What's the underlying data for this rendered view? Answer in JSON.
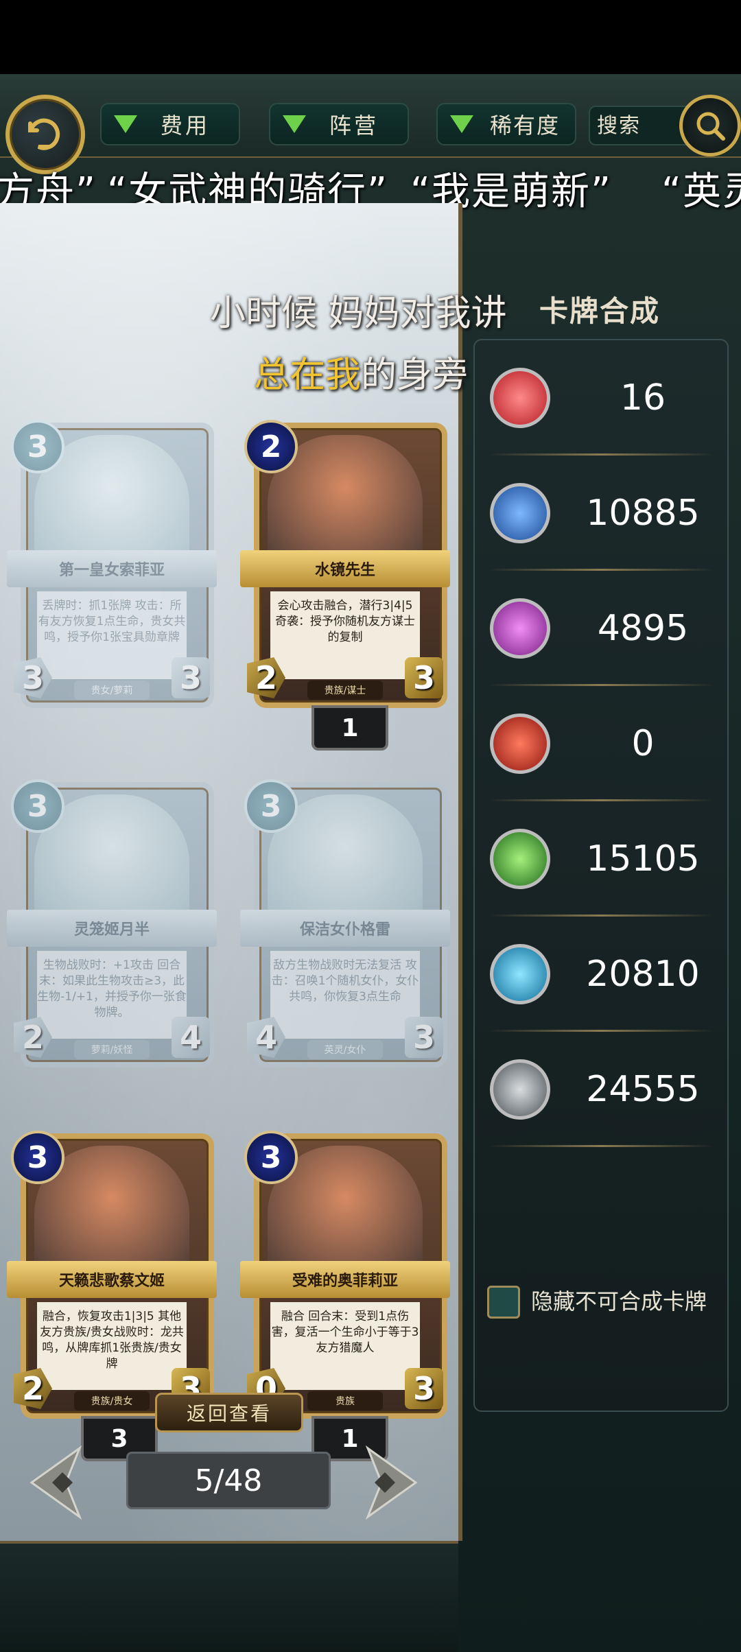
{
  "filters": [
    {
      "label": "费用"
    },
    {
      "label": "阵营"
    },
    {
      "label": "稀有度"
    }
  ],
  "search": {
    "label": "搜索"
  },
  "marquee": [
    "方舟”",
    "“女武神的骑行”",
    "“我是萌新”",
    "“英灵"
  ],
  "lyrics": {
    "line1": "小时候 妈妈对我讲",
    "line2_highlight": "总在我",
    "line2_rest": "的身旁"
  },
  "panel_title": "卡牌合成",
  "cards": [
    {
      "cost": "3",
      "name": "第一皇女索菲亚",
      "desc": "丢牌时：抓1张牌 攻击：所有友方恢复1点生命，贵女共鸣，授予你1张宝具勋章牌",
      "atk": "3",
      "hp": "3",
      "tribe": "贵女/萝莉",
      "count": null,
      "faded": true
    },
    {
      "cost": "2",
      "name": "水镜先生",
      "desc": "会心攻击融合，潜行3|4|5 奇袭：授予你随机友方谋士的复制",
      "atk": "2",
      "hp": "3",
      "tribe": "贵族/谋士",
      "count": "1",
      "faded": false
    },
    {
      "cost": "3",
      "name": "灵笼姬月半",
      "desc": "生物战败时：+1攻击 回合末：如果此生物攻击≥3，此生物-1/+1，并授予你一张食物牌。",
      "atk": "2",
      "hp": "4",
      "tribe": "萝莉/妖怪",
      "count": null,
      "faded": true
    },
    {
      "cost": "3",
      "name": "保洁女仆格雷",
      "desc": "敌方生物战败时无法复活 攻击：召唤1个随机女仆，女仆共鸣，你恢复3点生命",
      "atk": "4",
      "hp": "3",
      "tribe": "英灵/女仆",
      "count": null,
      "faded": true
    },
    {
      "cost": "3",
      "name": "天籁悲歌蔡文姬",
      "desc": "融合，恢复攻击1|3|5 其他友方贵族/贵女战败时：龙共鸣，从牌库抓1张贵族/贵女牌",
      "atk": "2",
      "hp": "3",
      "tribe": "贵族/贵女",
      "count": "3",
      "faded": false
    },
    {
      "cost": "3",
      "name": "受难的奥菲莉亚",
      "desc": "融合 回合末：受到1点伤害，复活一个生命小于等于3友方猎魔人",
      "atk": "0",
      "hp": "3",
      "tribe": "贵族",
      "count": "1",
      "faded": false
    }
  ],
  "return_button": "返回查看",
  "page_indicator": "5/48",
  "resources": [
    {
      "icon": "red-gem-icon",
      "value": "16",
      "color": "#d8343a"
    },
    {
      "icon": "blue-crown-icon",
      "value": "10885",
      "color": "#2f6fc4"
    },
    {
      "icon": "purple-faction-icon",
      "value": "4895",
      "color": "#b03cb8"
    },
    {
      "icon": "red-faction-icon",
      "value": "0",
      "color": "#c62a22"
    },
    {
      "icon": "green-faction-icon",
      "value": "15105",
      "color": "#3aa83a"
    },
    {
      "icon": "cyan-faction-icon",
      "value": "20810",
      "color": "#1aa6d8"
    },
    {
      "icon": "gray-faction-icon",
      "value": "24555",
      "color": "#8a8f94"
    }
  ],
  "hide_option": {
    "label": "隐藏不可合成卡牌",
    "checked": false
  },
  "colors": {
    "accent_gold": "#c9a84b",
    "panel_bg": "#1c2a2b",
    "filter_green": "#6fd14a"
  }
}
